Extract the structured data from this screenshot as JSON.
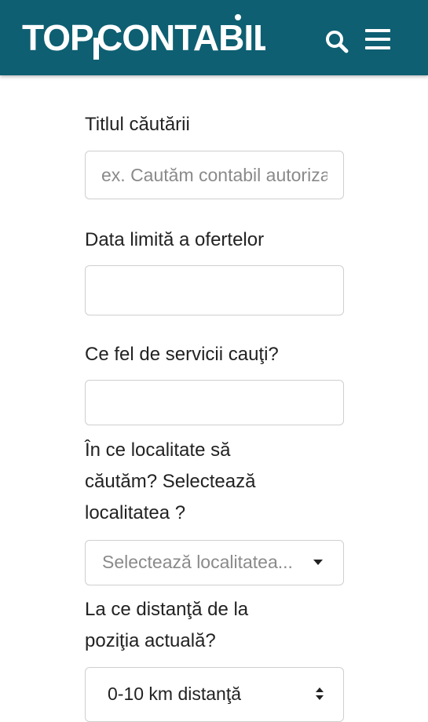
{
  "header": {
    "logo_text": "TOPCONTABIL",
    "background_color": "#0e5f72",
    "search_icon": "search-icon",
    "menu_icon": "hamburger-menu-icon"
  },
  "form": {
    "title_label": "Titlul căutării",
    "title_placeholder": "ex. Cautăm contabil autorizat",
    "title_value": "",
    "deadline_label": "Data limită a ofertelor",
    "deadline_value": "",
    "services_label": "Ce fel de servicii cauţi?",
    "services_value": "",
    "locality_label": "În ce localitate să\ncăutăm? Selectează\nlocalitatea ?",
    "locality_placeholder": "Selectează localitatea...",
    "distance_label": "La ce distanţă de la\npoziţia actuală?",
    "distance_selected": "0-10 km distanţă"
  }
}
